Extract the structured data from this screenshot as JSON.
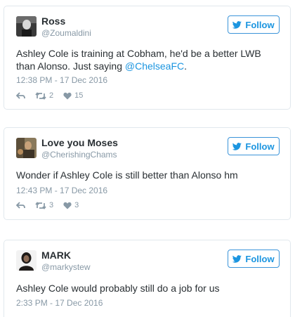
{
  "colors": {
    "link": "#1b95e0",
    "muted": "#8899a6",
    "border": "#e1e8ed"
  },
  "follow_label": "Follow",
  "tweets": [
    {
      "name": "Ross",
      "handle": "@Zoumaldini",
      "text_before": "Ashley Cole is training at Cobham, he'd be a better LWB than Alonso. Just saying ",
      "mention": "@ChelseaFC",
      "text_after": ".",
      "date": "12:38 PM - 17 Dec 2016",
      "retweets": "2",
      "likes": "15"
    },
    {
      "name": "Love you Moses",
      "handle": "@CherishingChams",
      "text": "Wonder if Ashley Cole is still better than Alonso hm",
      "date": "12:43 PM - 17 Dec 2016",
      "retweets": "3",
      "likes": "3"
    },
    {
      "name": "MARK",
      "handle": "@markystew",
      "text": "Ashley Cole would probably still do a job for us",
      "date": "2:33 PM - 17 Dec 2016"
    }
  ]
}
